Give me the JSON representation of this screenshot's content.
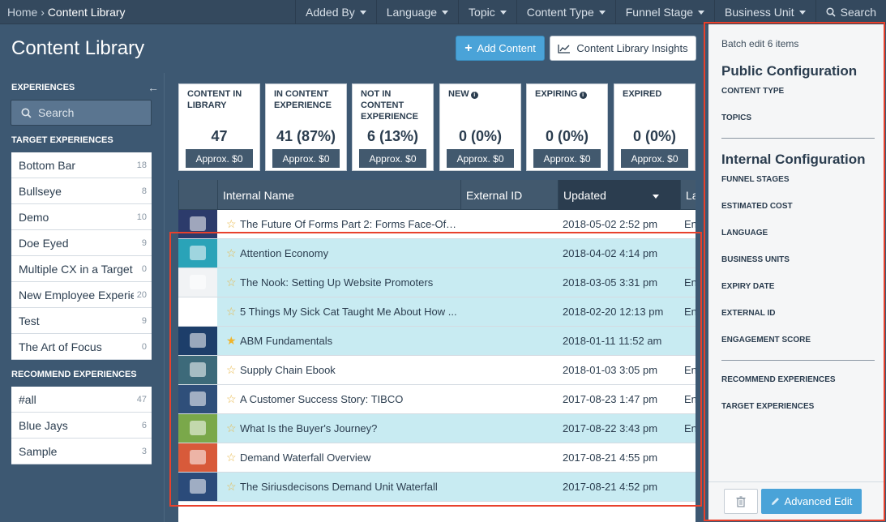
{
  "topbar": {
    "breadcrumb_home": "Home",
    "breadcrumb_sep": "›",
    "breadcrumb_current": "Content Library",
    "filters": [
      "Added By",
      "Language",
      "Topic",
      "Content Type",
      "Funnel Stage",
      "Business Unit"
    ],
    "search_label": "Search"
  },
  "header": {
    "title": "Content Library",
    "add_button": "Add Content",
    "insights_button": "Content Library Insights"
  },
  "sidebar": {
    "heading": "EXPERIENCES",
    "search_placeholder": "Search",
    "target_heading": "TARGET EXPERIENCES",
    "target_items": [
      {
        "label": "Bottom Bar",
        "count": "18"
      },
      {
        "label": "Bullseye",
        "count": "8"
      },
      {
        "label": "Demo",
        "count": "10"
      },
      {
        "label": "Doe Eyed",
        "count": "9"
      },
      {
        "label": "Multiple CX in a Target",
        "count": "0"
      },
      {
        "label": "New Employee Experie...",
        "count": "20"
      },
      {
        "label": "Test",
        "count": "9"
      },
      {
        "label": "The Art of Focus",
        "count": "0"
      }
    ],
    "recommend_heading": "RECOMMEND EXPERIENCES",
    "recommend_items": [
      {
        "label": "#all",
        "count": "47"
      },
      {
        "label": "Blue Jays",
        "count": "6"
      },
      {
        "label": "Sample",
        "count": "3"
      }
    ]
  },
  "stats": [
    {
      "label": "CONTENT IN LIBRARY",
      "value": "47",
      "cost": "Approx. $0"
    },
    {
      "label": "IN CONTENT EXPERIENCE",
      "value": "41 (87%)",
      "cost": "Approx. $0"
    },
    {
      "label": "NOT IN CONTENT EXPERIENCE",
      "value": "6 (13%)",
      "cost": "Approx. $0"
    },
    {
      "label": "NEW",
      "value": "0 (0%)",
      "cost": "Approx. $0"
    },
    {
      "label": "EXPIRING",
      "value": "0 (0%)",
      "cost": "Approx. $0"
    },
    {
      "label": "EXPIRED",
      "value": "0 (0%)",
      "cost": "Approx. $0"
    }
  ],
  "table": {
    "columns": [
      "Internal Name",
      "External ID",
      "Updated",
      "La"
    ],
    "rows": [
      {
        "name": "The Future Of Forms Part 2: Forms Face-Off ...",
        "date": "2018-05-02 2:52 pm",
        "lang": "En",
        "starred": false,
        "selected": false,
        "thumb_color": "#2c3b6b"
      },
      {
        "name": "Attention Economy",
        "date": "2018-04-02 4:14 pm",
        "lang": "",
        "starred": false,
        "selected": true,
        "thumb_color": "#2aa3b8"
      },
      {
        "name": "The Nook: Setting Up Website Promoters",
        "date": "2018-03-05 3:31 pm",
        "lang": "En",
        "starred": false,
        "selected": true,
        "thumb_color": "#f1f3f5"
      },
      {
        "name": "5 Things My Sick Cat Taught Me About How ...",
        "date": "2018-02-20 12:13 pm",
        "lang": "En",
        "starred": false,
        "selected": true,
        "thumb_color": "#ffffff"
      },
      {
        "name": "ABM Fundamentals",
        "date": "2018-01-11 11:52 am",
        "lang": "",
        "starred": true,
        "selected": true,
        "thumb_color": "#1d3e6a"
      },
      {
        "name": "Supply Chain Ebook",
        "date": "2018-01-03 3:05 pm",
        "lang": "En",
        "starred": false,
        "selected": false,
        "thumb_color": "#3d6a7a"
      },
      {
        "name": "A Customer Success Story: TIBCO",
        "date": "2017-08-23 1:47 pm",
        "lang": "En",
        "starred": false,
        "selected": false,
        "thumb_color": "#2f4f7a"
      },
      {
        "name": "What Is the Buyer's Journey?",
        "date": "2017-08-22 3:43 pm",
        "lang": "En",
        "starred": false,
        "selected": true,
        "thumb_color": "#7aa84a"
      },
      {
        "name": "Demand Waterfall Overview",
        "date": "2017-08-21 4:55 pm",
        "lang": "",
        "starred": false,
        "selected": false,
        "thumb_color": "#d85a3a"
      },
      {
        "name": "The Siriusdecisons Demand Unit Waterfall",
        "date": "2017-08-21 4:52 pm",
        "lang": "",
        "starred": false,
        "selected": true,
        "thumb_color": "#2b4b7a"
      }
    ]
  },
  "panel": {
    "batch_text": "Batch edit 6 items",
    "public_heading": "Public Configuration",
    "public_fields": [
      "CONTENT TYPE",
      "TOPICS"
    ],
    "internal_heading": "Internal Configuration",
    "internal_fields": [
      "FUNNEL STAGES",
      "ESTIMATED COST",
      "LANGUAGE",
      "BUSINESS UNITS",
      "EXPIRY DATE",
      "EXTERNAL ID",
      "ENGAGEMENT SCORE"
    ],
    "experience_fields": [
      "RECOMMEND EXPERIENCES",
      "TARGET EXPERIENCES"
    ],
    "advanced_edit": "Advanced Edit"
  },
  "colors": {
    "accent": "#4aa3d8",
    "highlight_box": "#e8412c",
    "selected_row": "#c8ebf2",
    "background": "#3d5872"
  }
}
